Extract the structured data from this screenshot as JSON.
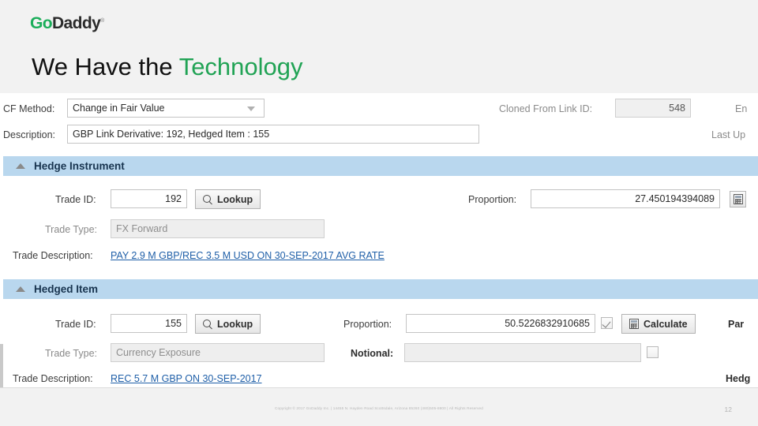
{
  "slide": {
    "logo": {
      "part1": "Go",
      "part2": "Daddy",
      "tm": "®"
    },
    "title_plain": "We Have the ",
    "title_accent": "Technology",
    "accent_color": "#21a355",
    "page_number": "12",
    "footer": "Copyright © 2017 GoDaddy Inc.  |  14455 N. Hayden Road Scottsdale, Arizona 85260 (480)505-8800  |  All Rights Reserved"
  },
  "app": {
    "top_form": {
      "cf_method_label": "CF Method:",
      "cf_method_value": "Change in Fair Value",
      "description_label": "Description:",
      "description_value": "GBP Link Derivative: 192, Hedged Item : 155",
      "cloned_from_label": "Cloned From Link ID:",
      "cloned_from_value": "548",
      "entered_label": "En",
      "last_updated_label": "Last Up"
    },
    "hedge_instrument": {
      "section_title": "Hedge Instrument",
      "trade_id_label": "Trade ID:",
      "trade_id_value": "192",
      "lookup_label": "Lookup",
      "proportion_label": "Proportion:",
      "proportion_value": "27.450194394089",
      "trade_type_label": "Trade Type:",
      "trade_type_value": "FX Forward",
      "trade_description_label": "Trade Description:",
      "trade_description_value": "PAY 2.9 M GBP/REC 3.5 M USD ON 30-SEP-2017 AVG RATE"
    },
    "hedged_item": {
      "section_title": "Hedged Item",
      "trade_id_label": "Trade ID:",
      "trade_id_value": "155",
      "lookup_label": "Lookup",
      "proportion_label": "Proportion:",
      "proportion_value": "50.5226832910685",
      "calculate_label": "Calculate",
      "partial_label": "Par",
      "trade_type_label": "Trade Type:",
      "trade_type_value": "Currency Exposure",
      "notional_label": "Notional:",
      "notional_value": "",
      "hedge_trailing_label": "Hedg",
      "trade_description_label": "Trade Description:",
      "trade_description_value": "REC 5.7 M GBP ON 30-SEP-2017"
    }
  }
}
